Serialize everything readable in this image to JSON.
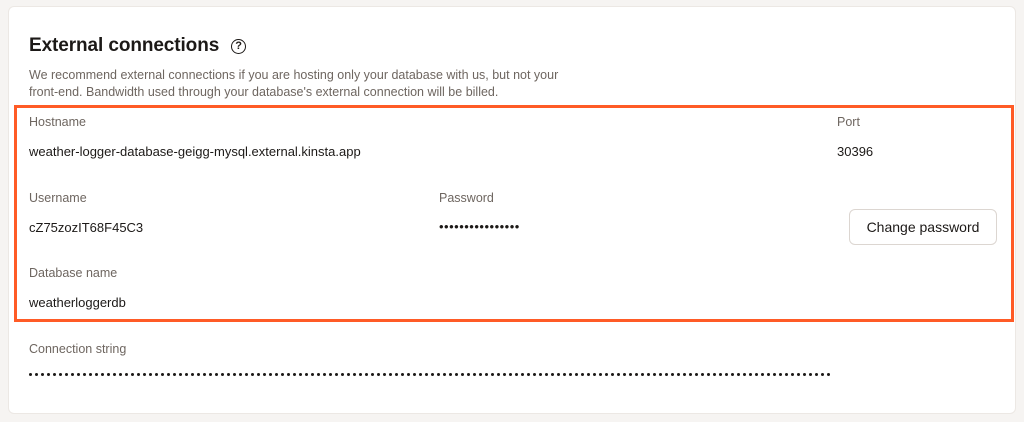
{
  "section": {
    "title": "External connections",
    "help_icon": "question-circle-icon",
    "description": "We recommend external connections if you are hosting only your database with us, but not your front-end. Bandwidth used through your database's external connection will be billed."
  },
  "fields": {
    "hostname_label": "Hostname",
    "hostname_value": "weather-logger-database-geigg-mysql.external.kinsta.app",
    "port_label": "Port",
    "port_value": "30396",
    "username_label": "Username",
    "username_value": "cZ75zozIT68F45C3",
    "password_label": "Password",
    "password_value": "••••••••••••••••",
    "dbname_label": "Database name",
    "dbname_value": "weatherloggerdb",
    "connection_label": "Connection string"
  },
  "actions": {
    "change_password_label": "Change password"
  },
  "colors": {
    "highlight": "#ff5b26"
  }
}
